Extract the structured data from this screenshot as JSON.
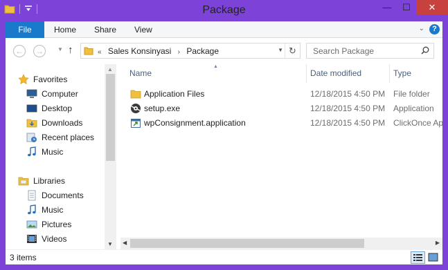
{
  "window": {
    "title": "Package"
  },
  "ribbon": {
    "tabs": [
      {
        "label": "File"
      },
      {
        "label": "Home"
      },
      {
        "label": "Share"
      },
      {
        "label": "View"
      }
    ],
    "help_label": "?"
  },
  "address": {
    "overflow": "«",
    "crumbs": [
      "Sales Konsinyasi",
      "Package"
    ],
    "separator": "›"
  },
  "search": {
    "placeholder": "Search Package"
  },
  "navpane": {
    "groups": [
      {
        "label": "Favorites",
        "icon": "star-icon",
        "items": [
          {
            "label": "Computer",
            "icon": "computer-icon"
          },
          {
            "label": "Desktop",
            "icon": "desktop-icon"
          },
          {
            "label": "Downloads",
            "icon": "downloads-icon"
          },
          {
            "label": "Recent places",
            "icon": "recent-places-icon"
          },
          {
            "label": "Music",
            "icon": "music-icon"
          }
        ]
      },
      {
        "label": "Libraries",
        "icon": "libraries-icon",
        "items": [
          {
            "label": "Documents",
            "icon": "documents-icon"
          },
          {
            "label": "Music",
            "icon": "music-icon"
          },
          {
            "label": "Pictures",
            "icon": "pictures-icon"
          },
          {
            "label": "Videos",
            "icon": "videos-icon"
          }
        ]
      }
    ]
  },
  "columns": {
    "name": "Name",
    "date": "Date modified",
    "type": "Type"
  },
  "files": [
    {
      "name": "Application Files",
      "date": "12/18/2015 4:50 PM",
      "type": "File folder",
      "icon": "folder-icon"
    },
    {
      "name": "setup.exe",
      "date": "12/18/2015 4:50 PM",
      "type": "Application",
      "icon": "setup-exe-icon"
    },
    {
      "name": "wpConsignment.application",
      "date": "12/18/2015 4:50 PM",
      "type": "ClickOnce Ap",
      "icon": "clickonce-icon"
    }
  ],
  "status": {
    "count": "3 items"
  },
  "colors": {
    "frame": "#7d43d8",
    "accent": "#1979ca",
    "close": "#c7413f",
    "folder": "#f0c040"
  }
}
